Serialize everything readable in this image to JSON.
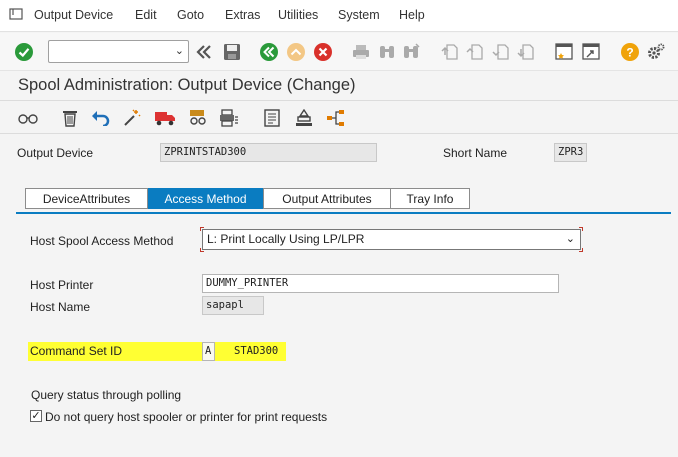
{
  "menubar": {
    "items": [
      "Output Device",
      "Edit",
      "Goto",
      "Extras",
      "Utilities",
      "System",
      "Help"
    ]
  },
  "toolbar": {
    "command_field_value": "",
    "icons": [
      "enter-icon",
      "back-double-icon",
      "save-icon",
      "back-icon",
      "exit-icon",
      "cancel-icon",
      "print-icon",
      "find-icon",
      "find-next-icon",
      "first-page-icon",
      "previous-page-icon",
      "next-page-icon",
      "last-page-icon",
      "create-session-icon",
      "shortcut-icon",
      "help-icon",
      "settings-icon"
    ]
  },
  "page": {
    "title": "Spool Administration: Output Device (Change)"
  },
  "app_toolbar": {
    "icons": [
      "display-change-icon",
      "delete-icon",
      "undo-icon",
      "magic-wand-icon",
      "truck-icon",
      "device-icon",
      "print-config-icon",
      "document-icon",
      "stamp-icon",
      "hierarchy-icon"
    ]
  },
  "header": {
    "output_device_label": "Output Device",
    "output_device_value": "ZPRINTSTAD300",
    "short_name_label": "Short Name",
    "short_name_value": "ZPR3"
  },
  "tabs": [
    {
      "label": "DeviceAttributes",
      "active": false
    },
    {
      "label": "Access Method",
      "active": true
    },
    {
      "label": "Output Attributes",
      "active": false
    },
    {
      "label": "Tray Info",
      "active": false
    }
  ],
  "access_method": {
    "host_spool_label": "Host Spool Access Method",
    "host_spool_value": "L: Print Locally Using LP/LPR",
    "host_printer_label": "Host Printer",
    "host_printer_value": "DUMMY_PRINTER",
    "host_name_label": "Host Name",
    "host_name_value": "sapapl",
    "command_set_label": "Command Set ID",
    "command_set_value": "A",
    "command_set_desc": "STAD300",
    "query_status_label": "Query status through polling",
    "no_query_label": "Do not query host spooler or printer for print requests",
    "no_query_checked": true
  },
  "colors": {
    "accent": "#0a7cc1",
    "highlight": "#ffff33",
    "enter_green": "#2a9a3a",
    "cancel_red": "#d9312b",
    "help_orange": "#f0a30a"
  }
}
